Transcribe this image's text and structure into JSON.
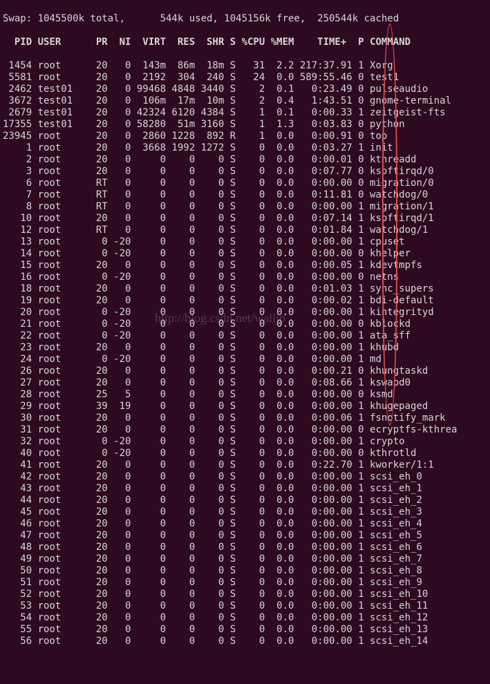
{
  "swap_line": "Swap: 1045500k total,      544k used, 1045156k free,  250544k cached",
  "header": "  PID USER      PR  NI  VIRT  RES  SHR S %CPU %MEM    TIME+  P COMMAND",
  "watermark": "http://blog.csdn.net/walljp",
  "rows": [
    {
      "pid": "1454",
      "user": "root",
      "pr": "20",
      "ni": "0",
      "virt": "143m",
      "res": "86m",
      "shr": "18m",
      "s": "S",
      "cpu": "31",
      "mem": "2.2",
      "time": "217:37.91",
      "p": "1",
      "cmd": "Xorg"
    },
    {
      "pid": "5581",
      "user": "root",
      "pr": "20",
      "ni": "0",
      "virt": "2192",
      "res": "304",
      "shr": "240",
      "s": "S",
      "cpu": "24",
      "mem": "0.0",
      "time": "589:55.46",
      "p": "0",
      "cmd": "test1"
    },
    {
      "pid": "2462",
      "user": "test01",
      "pr": "20",
      "ni": "0",
      "virt": "99468",
      "res": "4848",
      "shr": "3440",
      "s": "S",
      "cpu": "2",
      "mem": "0.1",
      "time": "0:23.49",
      "p": "0",
      "cmd": "pulseaudio"
    },
    {
      "pid": "3672",
      "user": "test01",
      "pr": "20",
      "ni": "0",
      "virt": "106m",
      "res": "17m",
      "shr": "10m",
      "s": "S",
      "cpu": "2",
      "mem": "0.4",
      "time": "1:43.51",
      "p": "0",
      "cmd": "gnome-terminal"
    },
    {
      "pid": "2679",
      "user": "test01",
      "pr": "20",
      "ni": "0",
      "virt": "42324",
      "res": "6120",
      "shr": "4384",
      "s": "S",
      "cpu": "1",
      "mem": "0.1",
      "time": "0:00.33",
      "p": "1",
      "cmd": "zeitgeist-fts"
    },
    {
      "pid": "17355",
      "user": "test01",
      "pr": "20",
      "ni": "0",
      "virt": "58280",
      "res": "51m",
      "shr": "3160",
      "s": "S",
      "cpu": "1",
      "mem": "1.3",
      "time": "0:03.83",
      "p": "0",
      "cmd": "python"
    },
    {
      "pid": "23945",
      "user": "root",
      "pr": "20",
      "ni": "0",
      "virt": "2860",
      "res": "1228",
      "shr": "892",
      "s": "R",
      "cpu": "1",
      "mem": "0.0",
      "time": "0:00.91",
      "p": "0",
      "cmd": "top"
    },
    {
      "pid": "1",
      "user": "root",
      "pr": "20",
      "ni": "0",
      "virt": "3668",
      "res": "1992",
      "shr": "1272",
      "s": "S",
      "cpu": "0",
      "mem": "0.0",
      "time": "0:03.27",
      "p": "1",
      "cmd": "init"
    },
    {
      "pid": "2",
      "user": "root",
      "pr": "20",
      "ni": "0",
      "virt": "0",
      "res": "0",
      "shr": "0",
      "s": "S",
      "cpu": "0",
      "mem": "0.0",
      "time": "0:00.01",
      "p": "0",
      "cmd": "kthreadd"
    },
    {
      "pid": "3",
      "user": "root",
      "pr": "20",
      "ni": "0",
      "virt": "0",
      "res": "0",
      "shr": "0",
      "s": "S",
      "cpu": "0",
      "mem": "0.0",
      "time": "0:07.77",
      "p": "0",
      "cmd": "ksoftirqd/0"
    },
    {
      "pid": "6",
      "user": "root",
      "pr": "RT",
      "ni": "0",
      "virt": "0",
      "res": "0",
      "shr": "0",
      "s": "S",
      "cpu": "0",
      "mem": "0.0",
      "time": "0:00.00",
      "p": "0",
      "cmd": "migration/0"
    },
    {
      "pid": "7",
      "user": "root",
      "pr": "RT",
      "ni": "0",
      "virt": "0",
      "res": "0",
      "shr": "0",
      "s": "S",
      "cpu": "0",
      "mem": "0.0",
      "time": "0:11.81",
      "p": "0",
      "cmd": "watchdog/0"
    },
    {
      "pid": "8",
      "user": "root",
      "pr": "RT",
      "ni": "0",
      "virt": "0",
      "res": "0",
      "shr": "0",
      "s": "S",
      "cpu": "0",
      "mem": "0.0",
      "time": "0:00.00",
      "p": "1",
      "cmd": "migration/1"
    },
    {
      "pid": "10",
      "user": "root",
      "pr": "20",
      "ni": "0",
      "virt": "0",
      "res": "0",
      "shr": "0",
      "s": "S",
      "cpu": "0",
      "mem": "0.0",
      "time": "0:07.14",
      "p": "1",
      "cmd": "ksoftirqd/1"
    },
    {
      "pid": "12",
      "user": "root",
      "pr": "RT",
      "ni": "0",
      "virt": "0",
      "res": "0",
      "shr": "0",
      "s": "S",
      "cpu": "0",
      "mem": "0.0",
      "time": "0:01.84",
      "p": "1",
      "cmd": "watchdog/1"
    },
    {
      "pid": "13",
      "user": "root",
      "pr": "0",
      "ni": "-20",
      "virt": "0",
      "res": "0",
      "shr": "0",
      "s": "S",
      "cpu": "0",
      "mem": "0.0",
      "time": "0:00.00",
      "p": "1",
      "cmd": "cpuset"
    },
    {
      "pid": "14",
      "user": "root",
      "pr": "0",
      "ni": "-20",
      "virt": "0",
      "res": "0",
      "shr": "0",
      "s": "S",
      "cpu": "0",
      "mem": "0.0",
      "time": "0:00.00",
      "p": "0",
      "cmd": "khelper"
    },
    {
      "pid": "15",
      "user": "root",
      "pr": "20",
      "ni": "0",
      "virt": "0",
      "res": "0",
      "shr": "0",
      "s": "S",
      "cpu": "0",
      "mem": "0.0",
      "time": "0:00.05",
      "p": "1",
      "cmd": "kdevtmpfs"
    },
    {
      "pid": "16",
      "user": "root",
      "pr": "0",
      "ni": "-20",
      "virt": "0",
      "res": "0",
      "shr": "0",
      "s": "S",
      "cpu": "0",
      "mem": "0.0",
      "time": "0:00.00",
      "p": "0",
      "cmd": "netns"
    },
    {
      "pid": "18",
      "user": "root",
      "pr": "20",
      "ni": "0",
      "virt": "0",
      "res": "0",
      "shr": "0",
      "s": "S",
      "cpu": "0",
      "mem": "0.0",
      "time": "0:01.03",
      "p": "1",
      "cmd": "sync_supers"
    },
    {
      "pid": "19",
      "user": "root",
      "pr": "20",
      "ni": "0",
      "virt": "0",
      "res": "0",
      "shr": "0",
      "s": "S",
      "cpu": "0",
      "mem": "0.0",
      "time": "0:00.02",
      "p": "1",
      "cmd": "bdi-default"
    },
    {
      "pid": "20",
      "user": "root",
      "pr": "0",
      "ni": "-20",
      "virt": "0",
      "res": "0",
      "shr": "0",
      "s": "S",
      "cpu": "0",
      "mem": "0.0",
      "time": "0:00.00",
      "p": "1",
      "cmd": "kintegrityd"
    },
    {
      "pid": "21",
      "user": "root",
      "pr": "0",
      "ni": "-20",
      "virt": "0",
      "res": "0",
      "shr": "0",
      "s": "S",
      "cpu": "0",
      "mem": "0.0",
      "time": "0:00.00",
      "p": "0",
      "cmd": "kblockd"
    },
    {
      "pid": "22",
      "user": "root",
      "pr": "0",
      "ni": "-20",
      "virt": "0",
      "res": "0",
      "shr": "0",
      "s": "S",
      "cpu": "0",
      "mem": "0.0",
      "time": "0:00.00",
      "p": "1",
      "cmd": "ata_sff"
    },
    {
      "pid": "23",
      "user": "root",
      "pr": "20",
      "ni": "0",
      "virt": "0",
      "res": "0",
      "shr": "0",
      "s": "S",
      "cpu": "0",
      "mem": "0.0",
      "time": "0:00.00",
      "p": "1",
      "cmd": "khubd"
    },
    {
      "pid": "24",
      "user": "root",
      "pr": "0",
      "ni": "-20",
      "virt": "0",
      "res": "0",
      "shr": "0",
      "s": "S",
      "cpu": "0",
      "mem": "0.0",
      "time": "0:00.00",
      "p": "1",
      "cmd": "md"
    },
    {
      "pid": "26",
      "user": "root",
      "pr": "20",
      "ni": "0",
      "virt": "0",
      "res": "0",
      "shr": "0",
      "s": "S",
      "cpu": "0",
      "mem": "0.0",
      "time": "0:00.21",
      "p": "0",
      "cmd": "khungtaskd"
    },
    {
      "pid": "27",
      "user": "root",
      "pr": "20",
      "ni": "0",
      "virt": "0",
      "res": "0",
      "shr": "0",
      "s": "S",
      "cpu": "0",
      "mem": "0.0",
      "time": "0:08.66",
      "p": "1",
      "cmd": "kswapd0"
    },
    {
      "pid": "28",
      "user": "root",
      "pr": "25",
      "ni": "5",
      "virt": "0",
      "res": "0",
      "shr": "0",
      "s": "S",
      "cpu": "0",
      "mem": "0.0",
      "time": "0:00.00",
      "p": "0",
      "cmd": "ksmd"
    },
    {
      "pid": "29",
      "user": "root",
      "pr": "39",
      "ni": "19",
      "virt": "0",
      "res": "0",
      "shr": "0",
      "s": "S",
      "cpu": "0",
      "mem": "0.0",
      "time": "0:00.00",
      "p": "1",
      "cmd": "khugepaged"
    },
    {
      "pid": "30",
      "user": "root",
      "pr": "20",
      "ni": "0",
      "virt": "0",
      "res": "0",
      "shr": "0",
      "s": "S",
      "cpu": "0",
      "mem": "0.0",
      "time": "0:00.06",
      "p": "1",
      "cmd": "fsnotify_mark"
    },
    {
      "pid": "31",
      "user": "root",
      "pr": "20",
      "ni": "0",
      "virt": "0",
      "res": "0",
      "shr": "0",
      "s": "S",
      "cpu": "0",
      "mem": "0.0",
      "time": "0:00.00",
      "p": "0",
      "cmd": "ecryptfs-kthrea"
    },
    {
      "pid": "32",
      "user": "root",
      "pr": "0",
      "ni": "-20",
      "virt": "0",
      "res": "0",
      "shr": "0",
      "s": "S",
      "cpu": "0",
      "mem": "0.0",
      "time": "0:00.00",
      "p": "1",
      "cmd": "crypto"
    },
    {
      "pid": "40",
      "user": "root",
      "pr": "0",
      "ni": "-20",
      "virt": "0",
      "res": "0",
      "shr": "0",
      "s": "S",
      "cpu": "0",
      "mem": "0.0",
      "time": "0:00.00",
      "p": "0",
      "cmd": "kthrotld"
    },
    {
      "pid": "41",
      "user": "root",
      "pr": "20",
      "ni": "0",
      "virt": "0",
      "res": "0",
      "shr": "0",
      "s": "S",
      "cpu": "0",
      "mem": "0.0",
      "time": "0:22.70",
      "p": "1",
      "cmd": "kworker/1:1"
    },
    {
      "pid": "42",
      "user": "root",
      "pr": "20",
      "ni": "0",
      "virt": "0",
      "res": "0",
      "shr": "0",
      "s": "S",
      "cpu": "0",
      "mem": "0.0",
      "time": "0:00.00",
      "p": "1",
      "cmd": "scsi_eh_0"
    },
    {
      "pid": "43",
      "user": "root",
      "pr": "20",
      "ni": "0",
      "virt": "0",
      "res": "0",
      "shr": "0",
      "s": "S",
      "cpu": "0",
      "mem": "0.0",
      "time": "0:00.00",
      "p": "1",
      "cmd": "scsi_eh_1"
    },
    {
      "pid": "44",
      "user": "root",
      "pr": "20",
      "ni": "0",
      "virt": "0",
      "res": "0",
      "shr": "0",
      "s": "S",
      "cpu": "0",
      "mem": "0.0",
      "time": "0:00.00",
      "p": "1",
      "cmd": "scsi_eh_2"
    },
    {
      "pid": "45",
      "user": "root",
      "pr": "20",
      "ni": "0",
      "virt": "0",
      "res": "0",
      "shr": "0",
      "s": "S",
      "cpu": "0",
      "mem": "0.0",
      "time": "0:00.00",
      "p": "1",
      "cmd": "scsi_eh_3"
    },
    {
      "pid": "46",
      "user": "root",
      "pr": "20",
      "ni": "0",
      "virt": "0",
      "res": "0",
      "shr": "0",
      "s": "S",
      "cpu": "0",
      "mem": "0.0",
      "time": "0:00.00",
      "p": "1",
      "cmd": "scsi_eh_4"
    },
    {
      "pid": "47",
      "user": "root",
      "pr": "20",
      "ni": "0",
      "virt": "0",
      "res": "0",
      "shr": "0",
      "s": "S",
      "cpu": "0",
      "mem": "0.0",
      "time": "0:00.00",
      "p": "1",
      "cmd": "scsi_eh_5"
    },
    {
      "pid": "48",
      "user": "root",
      "pr": "20",
      "ni": "0",
      "virt": "0",
      "res": "0",
      "shr": "0",
      "s": "S",
      "cpu": "0",
      "mem": "0.0",
      "time": "0:00.00",
      "p": "1",
      "cmd": "scsi_eh_6"
    },
    {
      "pid": "49",
      "user": "root",
      "pr": "20",
      "ni": "0",
      "virt": "0",
      "res": "0",
      "shr": "0",
      "s": "S",
      "cpu": "0",
      "mem": "0.0",
      "time": "0:00.00",
      "p": "1",
      "cmd": "scsi_eh_7"
    },
    {
      "pid": "50",
      "user": "root",
      "pr": "20",
      "ni": "0",
      "virt": "0",
      "res": "0",
      "shr": "0",
      "s": "S",
      "cpu": "0",
      "mem": "0.0",
      "time": "0:00.00",
      "p": "1",
      "cmd": "scsi_eh_8"
    },
    {
      "pid": "51",
      "user": "root",
      "pr": "20",
      "ni": "0",
      "virt": "0",
      "res": "0",
      "shr": "0",
      "s": "S",
      "cpu": "0",
      "mem": "0.0",
      "time": "0:00.00",
      "p": "1",
      "cmd": "scsi_eh_9"
    },
    {
      "pid": "52",
      "user": "root",
      "pr": "20",
      "ni": "0",
      "virt": "0",
      "res": "0",
      "shr": "0",
      "s": "S",
      "cpu": "0",
      "mem": "0.0",
      "time": "0:00.00",
      "p": "1",
      "cmd": "scsi_eh_10"
    },
    {
      "pid": "53",
      "user": "root",
      "pr": "20",
      "ni": "0",
      "virt": "0",
      "res": "0",
      "shr": "0",
      "s": "S",
      "cpu": "0",
      "mem": "0.0",
      "time": "0:00.00",
      "p": "1",
      "cmd": "scsi_eh_11"
    },
    {
      "pid": "54",
      "user": "root",
      "pr": "20",
      "ni": "0",
      "virt": "0",
      "res": "0",
      "shr": "0",
      "s": "S",
      "cpu": "0",
      "mem": "0.0",
      "time": "0:00.00",
      "p": "1",
      "cmd": "scsi_eh_12"
    },
    {
      "pid": "55",
      "user": "root",
      "pr": "20",
      "ni": "0",
      "virt": "0",
      "res": "0",
      "shr": "0",
      "s": "S",
      "cpu": "0",
      "mem": "0.0",
      "time": "0:00.00",
      "p": "1",
      "cmd": "scsi_eh_13"
    },
    {
      "pid": "56",
      "user": "root",
      "pr": "20",
      "ni": "0",
      "virt": "0",
      "res": "0",
      "shr": "0",
      "s": "S",
      "cpu": "0",
      "mem": "0.0",
      "time": "0:00.00",
      "p": "1",
      "cmd": "scsi_eh_14"
    }
  ]
}
